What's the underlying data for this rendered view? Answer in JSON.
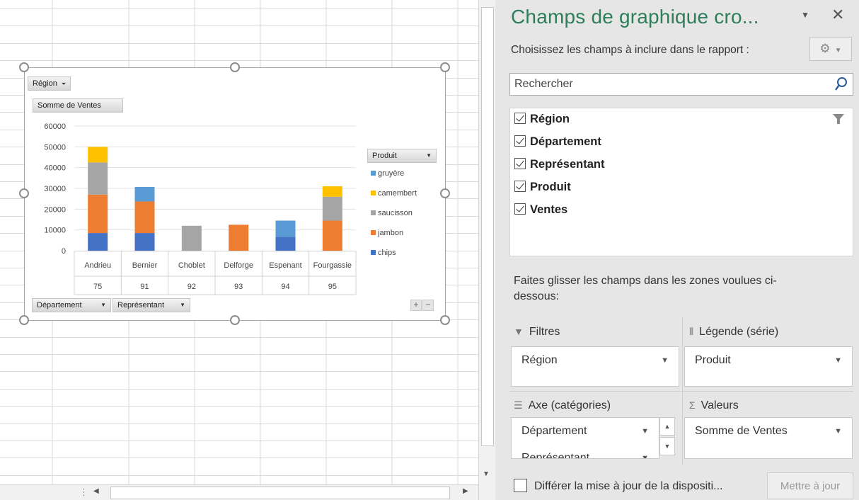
{
  "chart": {
    "filter_button": "Région",
    "value_button": "Somme de Ventes",
    "legend_button": "Produit",
    "axis_buttons": [
      "Département",
      "Représentant"
    ],
    "zoom_plus": "+",
    "zoom_minus": "−"
  },
  "chart_data": {
    "type": "bar",
    "stacked": true,
    "categories": [
      "Andrieu",
      "Bernier",
      "Choblet",
      "Delforge",
      "Espenant",
      "Fourgassie"
    ],
    "category_groups": [
      "75",
      "91",
      "92",
      "93",
      "94",
      "95"
    ],
    "series": [
      {
        "name": "chips",
        "color": "#4472c4",
        "values": [
          8500,
          8500,
          0,
          0,
          6700,
          0
        ]
      },
      {
        "name": "jambon",
        "color": "#ed7d31",
        "values": [
          18500,
          15200,
          0,
          12500,
          0,
          14500
        ]
      },
      {
        "name": "saucisson",
        "color": "#a5a5a5",
        "values": [
          15500,
          0,
          12000,
          0,
          0,
          11500
        ]
      },
      {
        "name": "camembert",
        "color": "#ffc000",
        "values": [
          7500,
          0,
          0,
          0,
          0,
          5000
        ]
      },
      {
        "name": "gruyère",
        "color": "#5b9bd5",
        "values": [
          0,
          7000,
          0,
          0,
          7800,
          0
        ]
      }
    ],
    "yticks": [
      0,
      10000,
      20000,
      30000,
      40000,
      50000,
      60000
    ],
    "ylim": [
      0,
      60000
    ],
    "legend_order": [
      "gruyère",
      "camembert",
      "saucisson",
      "jambon",
      "chips"
    ],
    "legend_placement": "right",
    "gridlines": true
  },
  "pane": {
    "title": "Champs de graphique cro...",
    "subtitle": "Choisissez les champs à inclure dans le rapport :",
    "search_placeholder": "Rechercher",
    "fields": [
      {
        "label": "Région",
        "checked": true
      },
      {
        "label": "Département",
        "checked": true
      },
      {
        "label": "Représentant",
        "checked": true
      },
      {
        "label": "Produit",
        "checked": true
      },
      {
        "label": "Ventes",
        "checked": true
      }
    ],
    "drag_hint": "Faites glisser les champs dans les zones voulues ci-dessous:",
    "zones": {
      "filters": {
        "label": "Filtres",
        "items": [
          "Région"
        ]
      },
      "legend": {
        "label": "Légende (série)",
        "items": [
          "Produit"
        ]
      },
      "axis": {
        "label": "Axe (catégories)",
        "items": [
          "Département",
          "Représentant"
        ]
      },
      "values": {
        "label": "Valeurs",
        "items": [
          "Somme de Ventes"
        ]
      }
    },
    "defer_label": "Différer la mise à jour de la dispositi...",
    "update_button": "Mettre à jour"
  }
}
